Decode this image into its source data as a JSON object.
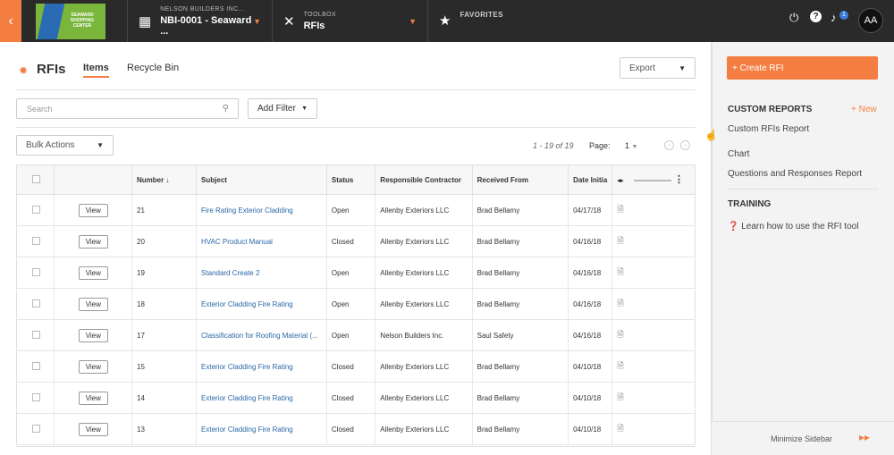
{
  "nav": {
    "company_small": "NELSON BUILDERS INC...",
    "project": "NBI-0001 - Seaward ...",
    "toolbox_small": "TOOLBOX",
    "tool": "RFIs",
    "favorites": "FAVORITES",
    "notif_count": "1",
    "avatar": "AA",
    "logo_text": "SEAWARD SHOPPING CENTER"
  },
  "header": {
    "title": "RFIs",
    "tabs": [
      "Items",
      "Recycle Bin"
    ],
    "export": "Export"
  },
  "filters": {
    "search_placeholder": "Search",
    "add_filter": "Add Filter",
    "bulk_actions": "Bulk Actions",
    "range": "1 - 19 of 19",
    "page_label": "Page:",
    "page": "1"
  },
  "table": {
    "columns": [
      "Number",
      "Subject",
      "Status",
      "Responsible Contractor",
      "Received From",
      "Date Initia"
    ],
    "view_label": "View",
    "rows": [
      {
        "number": "21",
        "subject": "Fire Rating Exterior Cladding",
        "status": "Open",
        "contractor": "Allenby Exteriors LLC",
        "from": "Brad Bellamy",
        "date": "04/17/18"
      },
      {
        "number": "20",
        "subject": "HVAC Product Manual",
        "status": "Closed",
        "contractor": "Allenby Exteriors LLC",
        "from": "Brad Bellamy",
        "date": "04/16/18"
      },
      {
        "number": "19",
        "subject": "Standard Create 2",
        "status": "Open",
        "contractor": "Allenby Exteriors LLC",
        "from": "Brad Bellamy",
        "date": "04/16/18"
      },
      {
        "number": "18",
        "subject": "Exterior Cladding Fire Rating",
        "status": "Open",
        "contractor": "Allenby Exteriors LLC",
        "from": "Brad Bellamy",
        "date": "04/16/18"
      },
      {
        "number": "17",
        "subject": "Classification for Roofing Material (...",
        "status": "Open",
        "contractor": "Nelson Builders Inc.",
        "from": "Saul Safety",
        "date": "04/16/18"
      },
      {
        "number": "15",
        "subject": "Exterior Cladding Fire Rating",
        "status": "Closed",
        "contractor": "Allenby Exteriors LLC",
        "from": "Brad Bellamy",
        "date": "04/10/18"
      },
      {
        "number": "14",
        "subject": "Exterior Cladding Fire Rating",
        "status": "Closed",
        "contractor": "Allenby Exteriors LLC",
        "from": "Brad Bellamy",
        "date": "04/10/18"
      },
      {
        "number": "13",
        "subject": "Exterior Cladding Fire Rating",
        "status": "Closed",
        "contractor": "Allenby Exteriors LLC",
        "from": "Brad Bellamy",
        "date": "04/10/18"
      }
    ]
  },
  "sidebar": {
    "create": "+ Create RFI",
    "custom_reports": "CUSTOM REPORTS",
    "new": "+ New",
    "reports": [
      "Custom RFIs Report",
      "Chart",
      "Questions and Responses Report"
    ],
    "training": "TRAINING",
    "training_link": "Learn how to use the RFI tool",
    "minimize": "Minimize Sidebar"
  },
  "colors": {
    "accent": "#f47e42",
    "link": "#2a68a8",
    "topbar": "#2a2a2a"
  }
}
